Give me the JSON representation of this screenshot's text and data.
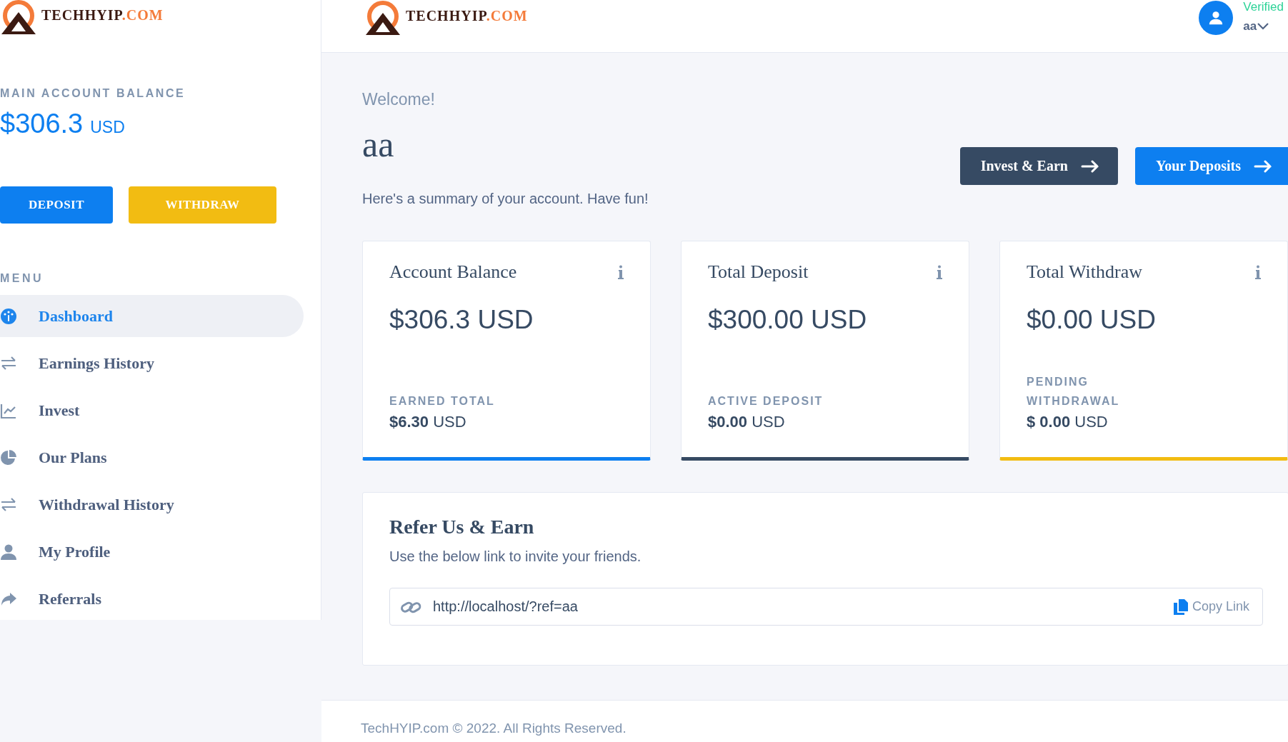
{
  "sidebar": {
    "brand": {
      "name": "TECHHYIP",
      "suffix": ".COM"
    },
    "balance_label": "MAIN ACCOUNT BALANCE",
    "balance": "$306.3",
    "balance_currency": "USD",
    "buttons": [
      {
        "label": "DEPOSIT",
        "kind": "primary"
      },
      {
        "label": "WITHDRAW",
        "kind": "warning"
      }
    ],
    "menu_label": "MENU",
    "items": [
      {
        "label": "Dashboard",
        "selected": true
      },
      {
        "label": "Earnings History",
        "selected": false
      },
      {
        "label": "Invest",
        "selected": false
      },
      {
        "label": "Our Plans",
        "selected": false
      },
      {
        "label": "Withdrawal History",
        "selected": false
      },
      {
        "label": "My Profile",
        "selected": false
      },
      {
        "label": "Referrals",
        "selected": false
      }
    ]
  },
  "header": {
    "brand": {
      "name": "TECHHYIP",
      "suffix": ".COM"
    },
    "status": "Verified",
    "username": "aa"
  },
  "welcome": {
    "greeting": "Welcome!",
    "name": "aa",
    "summary": "Here's a summary of your account. Have fun!",
    "buttons": [
      {
        "label": "Invest & Earn",
        "kind": "dark"
      },
      {
        "label": "Your Deposits",
        "kind": "primary"
      }
    ]
  },
  "cards": [
    {
      "title": "Account Balance",
      "amount": "$306.3 USD",
      "label": "EARNED TOTAL",
      "value": "**$6.30** USD",
      "color": "#0d7ff0"
    },
    {
      "title": "Total Deposit",
      "amount": "$300.00 USD",
      "label": "ACTIVE DEPOSIT",
      "value": "**$0.00** USD",
      "color": "#364a63"
    },
    {
      "title": "Total Withdraw",
      "amount": "$0.00 USD",
      "label": "PENDING WITHDRAWAL",
      "value": "**$ 0.00** USD",
      "color": "#f2bc12"
    }
  ],
  "referral": {
    "title": "Refer Us & Earn",
    "subtitle": "Use the below link to invite your friends.",
    "link": "http://localhost/?ref=aa",
    "copy": "Copy Link"
  },
  "footer": "TechHYIP.com © 2022. All Rights Reserved."
}
